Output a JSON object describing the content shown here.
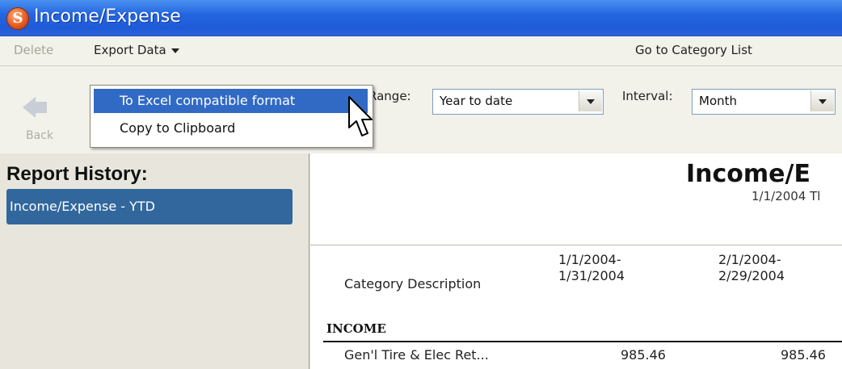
{
  "window": {
    "title": "Income/Expense",
    "icon": "app-logo-icon"
  },
  "menubar": {
    "delete_label": "Delete",
    "export_label": "Export Data",
    "goto_label": "Go to Category List"
  },
  "export_menu": {
    "items": [
      "To Excel compatible format",
      "Copy to Clipboard"
    ],
    "selected_index": 0
  },
  "toolbar": {
    "back_label": "Back",
    "range_label": "Range:",
    "range_value": "Year to date",
    "interval_label": "Interval:",
    "interval_value": "Month"
  },
  "sidebar": {
    "title": "Report History:",
    "items": [
      "Income/Expense - YTD"
    ]
  },
  "report": {
    "title": "Income/E",
    "date_range": "1/1/2004 Tl",
    "columns": {
      "desc": "Category Description",
      "col1_line1": "1/1/2004-",
      "col1_line2": "1/31/2004",
      "col2_line1": "2/1/2004-",
      "col2_line2": "2/29/2004"
    },
    "section": "INCOME",
    "rows": [
      {
        "desc": "Gen'l Tire & Elec Ret...",
        "v1": "985.46",
        "v2": "985.46"
      }
    ]
  },
  "colors": {
    "titlebar": "#2466e0",
    "selection": "#316ac5",
    "history_selected": "#31679d"
  }
}
